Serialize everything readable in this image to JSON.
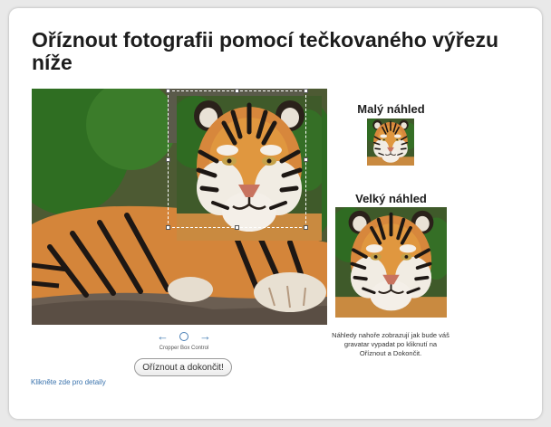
{
  "page": {
    "title": "Oříznout fotografii pomocí tečkovaného výřezu níže"
  },
  "crop": {
    "controls": {
      "left_arrow": "←",
      "center": "",
      "right_arrow": "→"
    },
    "controls_label": "Cropper Box Control",
    "finish_button": "Oříznout a dokončit!",
    "details_link": "Klikněte zde pro detaily"
  },
  "previews": {
    "small_title": "Malý náhled",
    "large_title": "Velký náhled",
    "note": "Náhledy nahoře zobrazují jak bude váš gravatar vypadat po kliknutí na Oříznout a Dokončit."
  },
  "icons": {
    "left": "arrow-left-icon",
    "center": "circle-icon",
    "right": "arrow-right-icon"
  }
}
